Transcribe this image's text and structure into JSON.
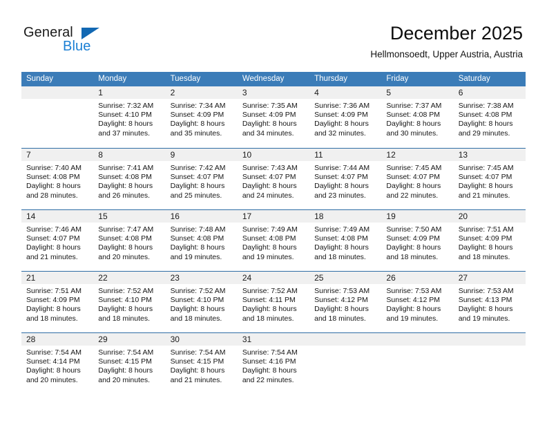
{
  "brand": {
    "name_top": "General",
    "name_bottom": "Blue",
    "triangle_color": "#1268b3",
    "blue_color": "#1a7fd4"
  },
  "header": {
    "title": "December 2025",
    "subtitle": "Hellmonsoedt, Upper Austria, Austria"
  },
  "theme": {
    "header_band": "#3b7cb8",
    "row_separator": "#2e6ca4",
    "day_number_band": "#f0f0f0"
  },
  "weekdays": [
    "Sunday",
    "Monday",
    "Tuesday",
    "Wednesday",
    "Thursday",
    "Friday",
    "Saturday"
  ],
  "labels": {
    "sunrise_prefix": "Sunrise:",
    "sunset_prefix": "Sunset:",
    "daylight_prefix": "Daylight:"
  },
  "weeks": [
    [
      {
        "day": "",
        "sunrise": "",
        "sunset": "",
        "daylight": "",
        "empty": true
      },
      {
        "day": "1",
        "sunrise": "Sunrise: 7:32 AM",
        "sunset": "Sunset: 4:10 PM",
        "daylight": "Daylight: 8 hours and 37 minutes."
      },
      {
        "day": "2",
        "sunrise": "Sunrise: 7:34 AM",
        "sunset": "Sunset: 4:09 PM",
        "daylight": "Daylight: 8 hours and 35 minutes."
      },
      {
        "day": "3",
        "sunrise": "Sunrise: 7:35 AM",
        "sunset": "Sunset: 4:09 PM",
        "daylight": "Daylight: 8 hours and 34 minutes."
      },
      {
        "day": "4",
        "sunrise": "Sunrise: 7:36 AM",
        "sunset": "Sunset: 4:09 PM",
        "daylight": "Daylight: 8 hours and 32 minutes."
      },
      {
        "day": "5",
        "sunrise": "Sunrise: 7:37 AM",
        "sunset": "Sunset: 4:08 PM",
        "daylight": "Daylight: 8 hours and 30 minutes."
      },
      {
        "day": "6",
        "sunrise": "Sunrise: 7:38 AM",
        "sunset": "Sunset: 4:08 PM",
        "daylight": "Daylight: 8 hours and 29 minutes."
      }
    ],
    [
      {
        "day": "7",
        "sunrise": "Sunrise: 7:40 AM",
        "sunset": "Sunset: 4:08 PM",
        "daylight": "Daylight: 8 hours and 28 minutes."
      },
      {
        "day": "8",
        "sunrise": "Sunrise: 7:41 AM",
        "sunset": "Sunset: 4:08 PM",
        "daylight": "Daylight: 8 hours and 26 minutes."
      },
      {
        "day": "9",
        "sunrise": "Sunrise: 7:42 AM",
        "sunset": "Sunset: 4:07 PM",
        "daylight": "Daylight: 8 hours and 25 minutes."
      },
      {
        "day": "10",
        "sunrise": "Sunrise: 7:43 AM",
        "sunset": "Sunset: 4:07 PM",
        "daylight": "Daylight: 8 hours and 24 minutes."
      },
      {
        "day": "11",
        "sunrise": "Sunrise: 7:44 AM",
        "sunset": "Sunset: 4:07 PM",
        "daylight": "Daylight: 8 hours and 23 minutes."
      },
      {
        "day": "12",
        "sunrise": "Sunrise: 7:45 AM",
        "sunset": "Sunset: 4:07 PM",
        "daylight": "Daylight: 8 hours and 22 minutes."
      },
      {
        "day": "13",
        "sunrise": "Sunrise: 7:45 AM",
        "sunset": "Sunset: 4:07 PM",
        "daylight": "Daylight: 8 hours and 21 minutes."
      }
    ],
    [
      {
        "day": "14",
        "sunrise": "Sunrise: 7:46 AM",
        "sunset": "Sunset: 4:07 PM",
        "daylight": "Daylight: 8 hours and 21 minutes."
      },
      {
        "day": "15",
        "sunrise": "Sunrise: 7:47 AM",
        "sunset": "Sunset: 4:08 PM",
        "daylight": "Daylight: 8 hours and 20 minutes."
      },
      {
        "day": "16",
        "sunrise": "Sunrise: 7:48 AM",
        "sunset": "Sunset: 4:08 PM",
        "daylight": "Daylight: 8 hours and 19 minutes."
      },
      {
        "day": "17",
        "sunrise": "Sunrise: 7:49 AM",
        "sunset": "Sunset: 4:08 PM",
        "daylight": "Daylight: 8 hours and 19 minutes."
      },
      {
        "day": "18",
        "sunrise": "Sunrise: 7:49 AM",
        "sunset": "Sunset: 4:08 PM",
        "daylight": "Daylight: 8 hours and 18 minutes."
      },
      {
        "day": "19",
        "sunrise": "Sunrise: 7:50 AM",
        "sunset": "Sunset: 4:09 PM",
        "daylight": "Daylight: 8 hours and 18 minutes."
      },
      {
        "day": "20",
        "sunrise": "Sunrise: 7:51 AM",
        "sunset": "Sunset: 4:09 PM",
        "daylight": "Daylight: 8 hours and 18 minutes."
      }
    ],
    [
      {
        "day": "21",
        "sunrise": "Sunrise: 7:51 AM",
        "sunset": "Sunset: 4:09 PM",
        "daylight": "Daylight: 8 hours and 18 minutes."
      },
      {
        "day": "22",
        "sunrise": "Sunrise: 7:52 AM",
        "sunset": "Sunset: 4:10 PM",
        "daylight": "Daylight: 8 hours and 18 minutes."
      },
      {
        "day": "23",
        "sunrise": "Sunrise: 7:52 AM",
        "sunset": "Sunset: 4:10 PM",
        "daylight": "Daylight: 8 hours and 18 minutes."
      },
      {
        "day": "24",
        "sunrise": "Sunrise: 7:52 AM",
        "sunset": "Sunset: 4:11 PM",
        "daylight": "Daylight: 8 hours and 18 minutes."
      },
      {
        "day": "25",
        "sunrise": "Sunrise: 7:53 AM",
        "sunset": "Sunset: 4:12 PM",
        "daylight": "Daylight: 8 hours and 18 minutes."
      },
      {
        "day": "26",
        "sunrise": "Sunrise: 7:53 AM",
        "sunset": "Sunset: 4:12 PM",
        "daylight": "Daylight: 8 hours and 19 minutes."
      },
      {
        "day": "27",
        "sunrise": "Sunrise: 7:53 AM",
        "sunset": "Sunset: 4:13 PM",
        "daylight": "Daylight: 8 hours and 19 minutes."
      }
    ],
    [
      {
        "day": "28",
        "sunrise": "Sunrise: 7:54 AM",
        "sunset": "Sunset: 4:14 PM",
        "daylight": "Daylight: 8 hours and 20 minutes."
      },
      {
        "day": "29",
        "sunrise": "Sunrise: 7:54 AM",
        "sunset": "Sunset: 4:15 PM",
        "daylight": "Daylight: 8 hours and 20 minutes."
      },
      {
        "day": "30",
        "sunrise": "Sunrise: 7:54 AM",
        "sunset": "Sunset: 4:15 PM",
        "daylight": "Daylight: 8 hours and 21 minutes."
      },
      {
        "day": "31",
        "sunrise": "Sunrise: 7:54 AM",
        "sunset": "Sunset: 4:16 PM",
        "daylight": "Daylight: 8 hours and 22 minutes."
      },
      {
        "day": "",
        "sunrise": "",
        "sunset": "",
        "daylight": "",
        "empty": true
      },
      {
        "day": "",
        "sunrise": "",
        "sunset": "",
        "daylight": "",
        "empty": true
      },
      {
        "day": "",
        "sunrise": "",
        "sunset": "",
        "daylight": "",
        "empty": true
      }
    ]
  ]
}
